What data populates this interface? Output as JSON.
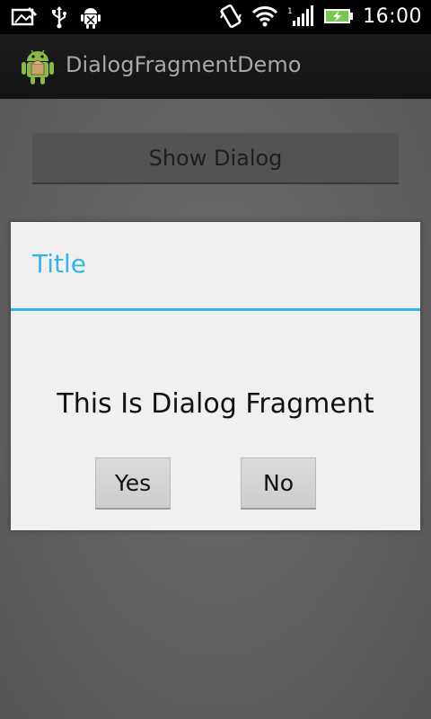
{
  "status_bar": {
    "time": "16:00",
    "icons": [
      "gallery-icon",
      "usb-icon",
      "android-debug-icon",
      "vibrate-icon",
      "wifi-icon",
      "signal-icon",
      "battery-charging-icon"
    ]
  },
  "action_bar": {
    "title": "DialogFragmentDemo",
    "icon": "android-app-icon"
  },
  "content": {
    "show_dialog_label": "Show Dialog"
  },
  "dialog": {
    "title": "Title",
    "message": "This Is Dialog Fragment",
    "yes_label": "Yes",
    "no_label": "No"
  },
  "colors": {
    "accent": "#33b5e5",
    "battery": "#7ac74f"
  }
}
